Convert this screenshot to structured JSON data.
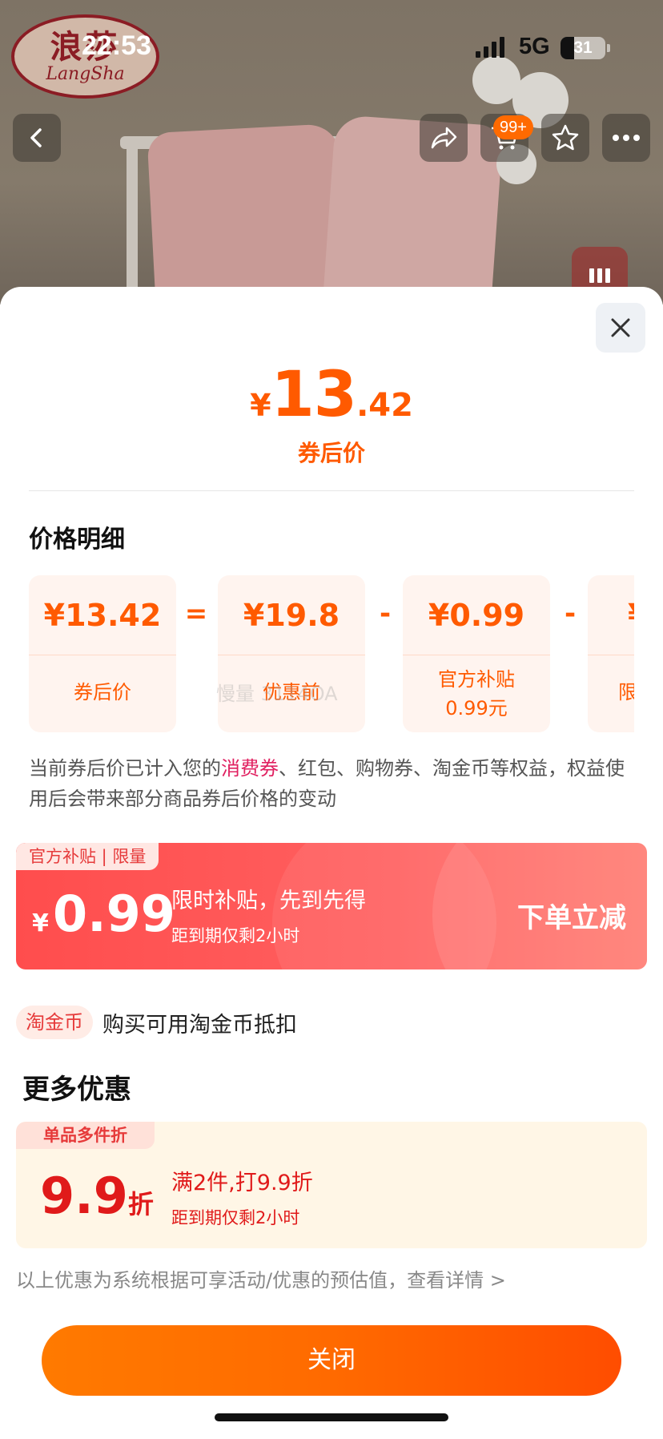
{
  "status_bar": {
    "time": "22:53",
    "network": "5G",
    "battery": "31",
    "battery_level": 0.31
  },
  "brand": {
    "logo_cn": "浪莎",
    "logo_en": "LangSha"
  },
  "nav": {
    "back_icon": "chevron-left-icon",
    "share_icon": "share-icon",
    "cart_icon": "cart-icon",
    "cart_badge": "99+",
    "favorite_icon": "star-icon",
    "more_icon": "more-icon",
    "side_icon": "bar-chart-icon"
  },
  "sheet": {
    "close_icon": "close-icon",
    "hero": {
      "currency": "¥",
      "integer": "13",
      "decimal": ".42",
      "label": "券后价"
    },
    "detail_title": "价格明细",
    "breakdown": [
      {
        "amount": "¥13.42",
        "label": "券后价",
        "label2": ""
      },
      {
        "amount": "¥19.8",
        "label": "优惠前",
        "label2": ""
      },
      {
        "amount": "¥0.99",
        "label": "官方补贴",
        "label2": "0.99元"
      },
      {
        "amount": "¥",
        "label": "限",
        "label2": ""
      }
    ],
    "operators": [
      "=",
      "-",
      "-"
    ],
    "watermark": "慢量 3114OA",
    "rights_note_part1": "当前券后价已计入您的",
    "rights_note_highlight": "消费券",
    "rights_note_part2": "、红包、购物券、淘金币等权益，权益使用后会带来部分商品券后价格的变动",
    "subsidy": {
      "tag": "官方补贴 | 限量",
      "currency": "¥",
      "amount": "0.99",
      "main_text": "限时补贴，先到先得",
      "sub_text": "距到期仅剩2小时",
      "action": "下单立减"
    },
    "coin": {
      "tag": "淘金币",
      "text": "购买可用淘金币抵扣"
    },
    "more_title": "更多优惠",
    "discount": {
      "tag": "单品多件折",
      "amount": "9.9",
      "unit": "折",
      "main_text": "满2件,打9.9折",
      "sub_text": "距到期仅剩2小时"
    },
    "footnote": "以上优惠为系统根据可享活动/优惠的预估值，查看详情 >",
    "close_button": "关闭"
  },
  "colors": {
    "accent": "#ff5a00",
    "subsidy_red": "#ff4d4d",
    "discount_red": "#e01a1a",
    "highlight_pink": "#e02060"
  }
}
